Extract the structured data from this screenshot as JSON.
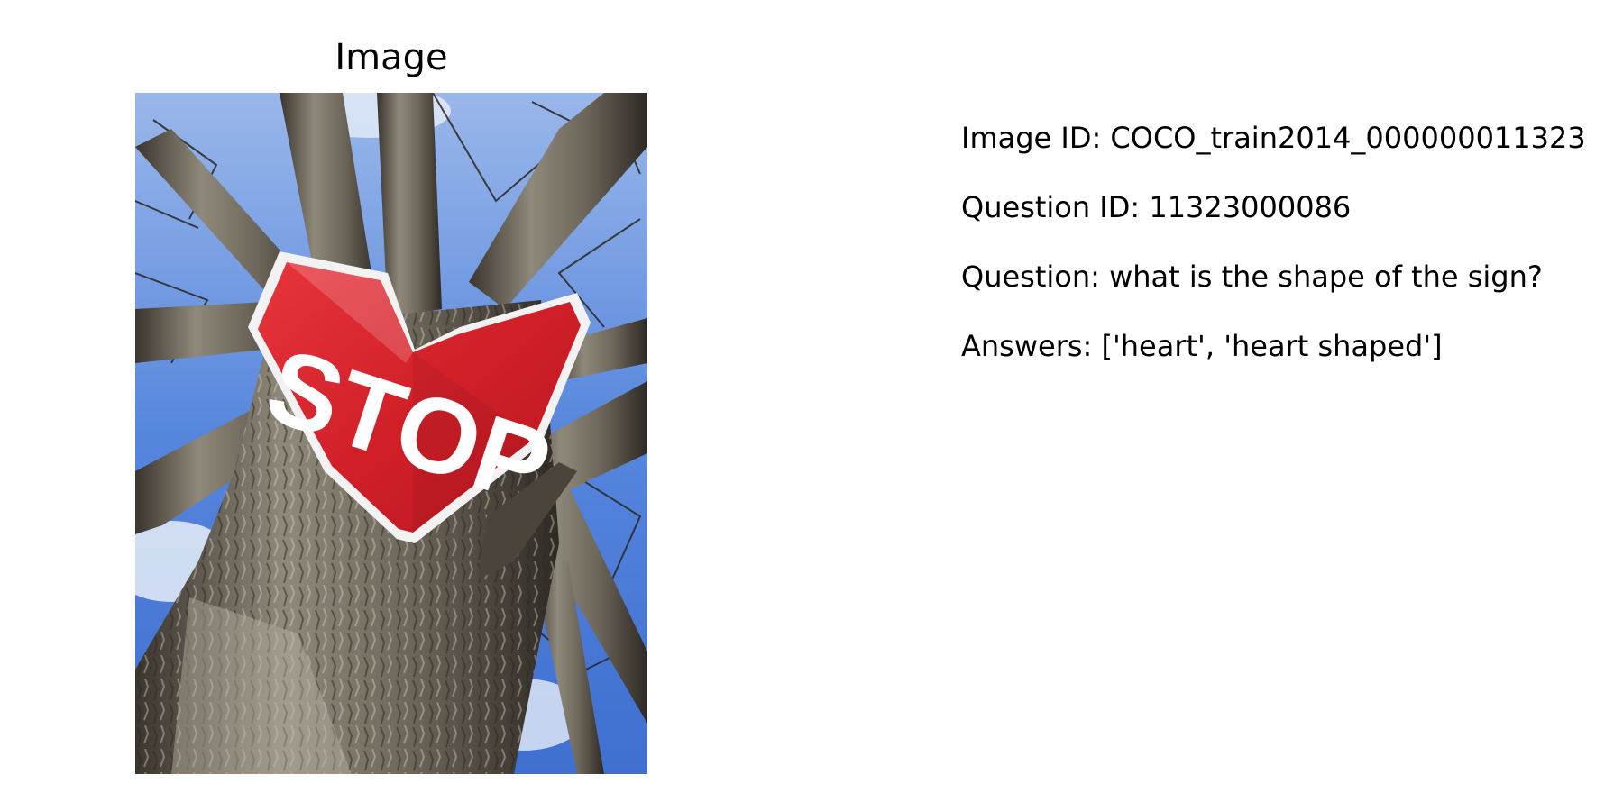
{
  "panel": {
    "title": "Image"
  },
  "photo": {
    "sign_text": "STOP",
    "colors": {
      "sky": "#4f7fd8",
      "cloud": "#e6edf8",
      "bark": "#5e584d",
      "bark_light": "#a8a294",
      "bark_dark": "#2e2a24",
      "sign_red": "#d7232c",
      "sign_white": "#ffffff"
    }
  },
  "info": {
    "image_id": "Image ID: COCO_train2014_000000011323",
    "question_id": "Question ID: 11323000086",
    "question": "Question: what is the shape of the sign?",
    "answers": "Answers: ['heart', 'heart shaped']"
  }
}
